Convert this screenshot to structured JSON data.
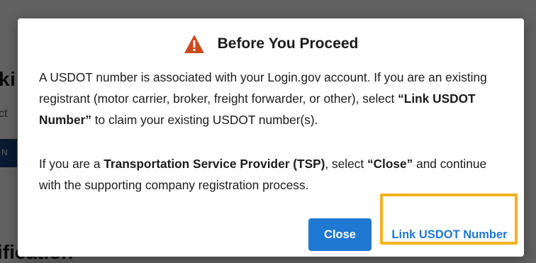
{
  "background": {
    "title_fragment": "ki",
    "subtitle_fragment": "ct",
    "bar_fragment": "N",
    "heading_fragment": "ification"
  },
  "modal": {
    "title": "Before You Proceed",
    "icon": "warning-triangle-icon",
    "icon_color": "#c94c1f",
    "paragraph1": {
      "part1": "A USDOT number is associated with your Login.gov account. If you are an existing registrant (motor carrier, broker, freight forwarder, or other), select ",
      "bold": "“Link USDOT Number”",
      "part2": " to claim your existing USDOT number(s)."
    },
    "paragraph2": {
      "part1": "If you are a ",
      "bold1": "Transportation Service Provider (TSP)",
      "part2": ", select ",
      "bold2": "“Close”",
      "part3": " and continue with the supporting company registration process."
    },
    "buttons": {
      "close_label": "Close",
      "link_label": "Link USDOT Number"
    }
  },
  "colors": {
    "primary": "#1f78d1",
    "highlight": "#f2b11e",
    "overlay": "rgba(0,0,0,0.62)"
  }
}
